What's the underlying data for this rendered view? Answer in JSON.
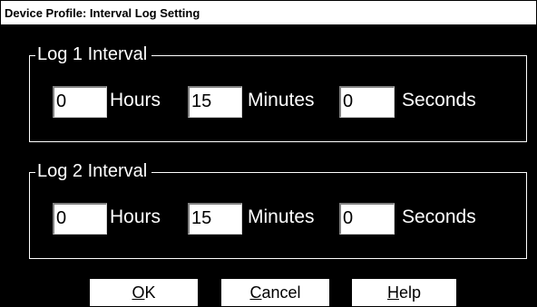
{
  "window": {
    "title": "Device Profile: Interval Log Setting"
  },
  "groups": [
    {
      "title": "Log 1 Interval",
      "hours": {
        "value": "0",
        "label": "Hours"
      },
      "minutes": {
        "value": "15",
        "label": "Minutes"
      },
      "seconds": {
        "value": "0",
        "label": "Seconds"
      }
    },
    {
      "title": "Log 2 Interval",
      "hours": {
        "value": "0",
        "label": "Hours"
      },
      "minutes": {
        "value": "15",
        "label": "Minutes"
      },
      "seconds": {
        "value": "0",
        "label": "Seconds"
      }
    }
  ],
  "buttons": {
    "ok": {
      "mnemonic": "O",
      "rest": "K"
    },
    "cancel": {
      "mnemonic": "C",
      "rest": "ancel"
    },
    "help": {
      "mnemonic": "H",
      "rest": "elp"
    }
  }
}
